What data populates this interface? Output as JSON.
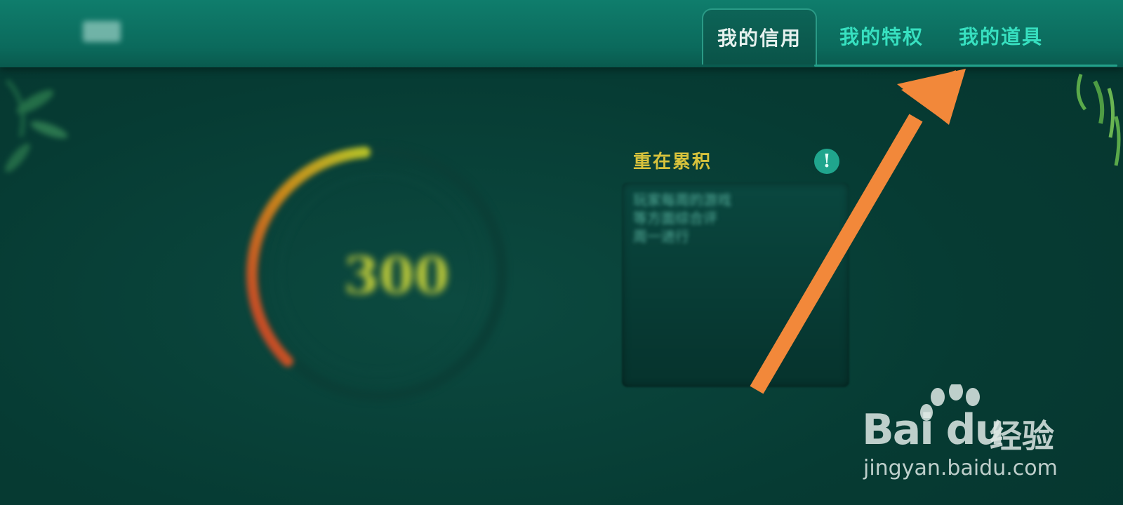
{
  "topbar": {
    "left_items": [
      "",
      "",
      ""
    ],
    "tabs": [
      {
        "label": "我的信用",
        "active": true
      },
      {
        "label": "我的特权",
        "active": false
      },
      {
        "label": "我的道具",
        "active": false
      }
    ]
  },
  "credit": {
    "score": "300",
    "sub": "",
    "button_label": "",
    "note": ""
  },
  "info": {
    "title_blurred": "",
    "title": "重在累积",
    "icon": "!",
    "body": "玩家每周的游戏\n等方面综合评\n周一进行"
  },
  "watermark": {
    "brand": "Bai du",
    "brand_cn": "经验",
    "url": "jingyan.baidu.com"
  },
  "colors": {
    "accent": "#37e0c0",
    "active_tab_text": "#e6f1ee",
    "arrow": "#f2883a",
    "gold": "#d7c23c"
  },
  "icons": [
    "info-icon",
    "bamboo-leaves-icon",
    "paw-icon",
    "pointer-arrow-icon"
  ]
}
